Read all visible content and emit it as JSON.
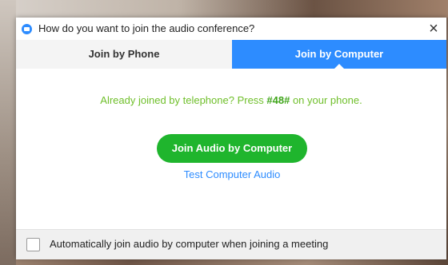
{
  "dialog": {
    "title": "How do you want to join the audio conference?",
    "close_label": "×"
  },
  "tabs": [
    {
      "label": "Join by Phone",
      "selected": false
    },
    {
      "label": "Join by Computer",
      "selected": true
    }
  ],
  "main": {
    "hint_before": "Already joined by telephone? Press ",
    "hint_code": "#48#",
    "hint_after": " on your phone.",
    "join_button_label": "Join Audio by Computer",
    "test_link_label": "Test Computer Audio"
  },
  "footer": {
    "checkbox_checked": false,
    "checkbox_label": "Automatically join audio by computer when joining a meeting"
  },
  "colors": {
    "accent_blue": "#2d8cff",
    "join_green": "#1fb52d",
    "hint_green": "#6fbf2a"
  },
  "icons": {
    "title_logo": "zoom-logo-icon",
    "close": "close-icon",
    "tab_pointer": "caret-up-icon"
  }
}
